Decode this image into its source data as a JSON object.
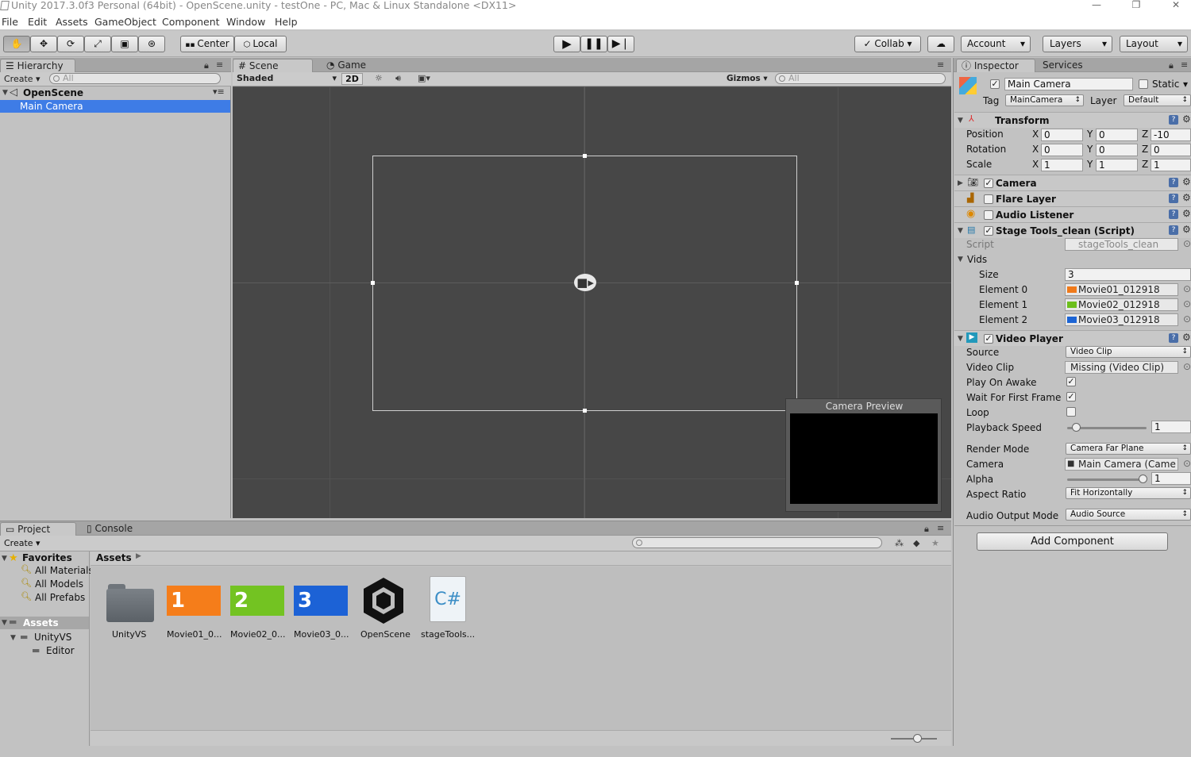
{
  "window": {
    "title": "Unity 2017.3.0f3 Personal (64bit) - OpenScene.unity - testOne - PC, Mac & Linux Standalone <DX11>",
    "minimize": "—",
    "maximize": "❐",
    "close": "✕"
  },
  "menu": [
    "File",
    "Edit",
    "Assets",
    "GameObject",
    "Component",
    "Window",
    "Help"
  ],
  "toolbar": {
    "center": "Center",
    "local": "Local",
    "collab": "Collab",
    "account": "Account",
    "layers": "Layers",
    "layout": "Layout"
  },
  "hierarchy": {
    "tab": "Hierarchy",
    "create": "Create",
    "search_placeholder": "All",
    "scene": "OpenScene",
    "items": [
      "Main Camera"
    ]
  },
  "scene": {
    "tab_scene": "Scene",
    "tab_game": "Game",
    "shading": "Shaded",
    "mode_2d": "2D",
    "gizmos": "Gizmos",
    "search_placeholder": "All",
    "camera_preview": "Camera Preview"
  },
  "inspector": {
    "tabs": [
      "Inspector",
      "Services"
    ],
    "object_name": "Main Camera",
    "static": "Static",
    "tag_label": "Tag",
    "tag": "MainCamera",
    "layer_label": "Layer",
    "layer": "Default",
    "transform": {
      "title": "Transform",
      "rows": [
        {
          "label": "Position",
          "x": "0",
          "y": "0",
          "z": "-10"
        },
        {
          "label": "Rotation",
          "x": "0",
          "y": "0",
          "z": "0"
        },
        {
          "label": "Scale",
          "x": "1",
          "y": "1",
          "z": "1"
        }
      ]
    },
    "components": [
      "Camera",
      "Flare Layer",
      "Audio Listener"
    ],
    "stage_tools": {
      "title": "Stage Tools_clean (Script)",
      "script_label": "Script",
      "script": "stageTools_clean",
      "vids_label": "Vids",
      "size_label": "Size",
      "size": "3",
      "elements": [
        {
          "label": "Element 0",
          "value": "Movie01_012918",
          "color": "#f07a1a"
        },
        {
          "label": "Element 1",
          "value": "Movie02_012918",
          "color": "#6cbf1c"
        },
        {
          "label": "Element 2",
          "value": "Movie03_012918",
          "color": "#1c64d4"
        }
      ]
    },
    "video_player": {
      "title": "Video Player",
      "rows": [
        {
          "label": "Source",
          "value": "Video Clip"
        },
        {
          "label": "Video Clip",
          "value": "Missing (Video Clip)"
        },
        {
          "label": "Play On Awake",
          "checked": "✓"
        },
        {
          "label": "Wait For First Frame",
          "checked": "✓"
        },
        {
          "label": "Loop",
          "checked": ""
        },
        {
          "label": "Playback Speed",
          "value": "1"
        },
        {
          "label": "Render Mode",
          "value": "Camera Far Plane"
        },
        {
          "label": "Camera",
          "value": "Main Camera (Came"
        },
        {
          "label": "Alpha",
          "value": "1"
        },
        {
          "label": "Aspect Ratio",
          "value": "Fit Horizontally"
        },
        {
          "label": "Audio Output Mode",
          "value": "Audio Source"
        }
      ]
    },
    "add_component": "Add Component"
  },
  "project": {
    "tab_project": "Project",
    "tab_console": "Console",
    "create": "Create",
    "favorites": "Favorites",
    "fav_items": [
      "All Materials",
      "All Models",
      "All Prefabs"
    ],
    "assets_root": "Assets",
    "tree": [
      "UnityVS",
      "Editor"
    ],
    "breadcrumb": "Assets",
    "assets": [
      {
        "name": "UnityVS",
        "glyph": ""
      },
      {
        "name": "Movie01_0...",
        "glyph": "1",
        "color": "#f57d1a"
      },
      {
        "name": "Movie02_0...",
        "glyph": "2",
        "color": "#73c322"
      },
      {
        "name": "Movie03_0...",
        "glyph": "3",
        "color": "#1c62d6"
      },
      {
        "name": "OpenScene",
        "glyph": ""
      },
      {
        "name": "stageTools...",
        "glyph": "C#"
      }
    ]
  }
}
